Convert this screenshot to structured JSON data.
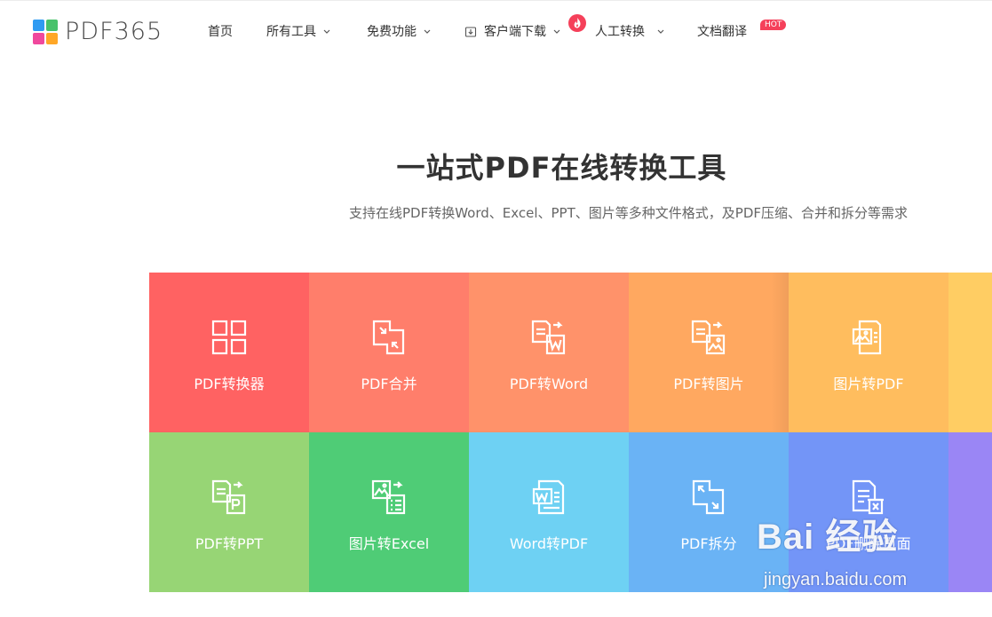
{
  "brand": {
    "name": "PDF365",
    "logo_colors": [
      "#2f9bf2",
      "#48c26b",
      "#f0489d",
      "#ffa726"
    ]
  },
  "nav": {
    "items": [
      {
        "label": "首页"
      },
      {
        "label": "所有工具"
      },
      {
        "label": "免费功能"
      },
      {
        "label": "客户端下载"
      },
      {
        "label": "人工转换"
      },
      {
        "label": "文档翻译"
      }
    ],
    "hot_badge": "HOT",
    "icons": {
      "download": "download-icon",
      "fire": "fire-icon",
      "chevron": "chevron-down-icon"
    }
  },
  "hero": {
    "title": "一站式PDF在线转换工具",
    "subtitle": "支持在线PDF转换Word、Excel、PPT、图片等多种文件格式，及PDF压缩、合并和拆分等需求"
  },
  "tools": [
    {
      "label": "PDF转换器",
      "color": "#ff6262",
      "icon": "grid-icon"
    },
    {
      "label": "PDF合并",
      "color": "#ff7e6b",
      "icon": "merge-icon"
    },
    {
      "label": "PDF转Word",
      "color": "#ff926a",
      "icon": "pdf-to-word-icon"
    },
    {
      "label": "PDF转图片",
      "color": "#ffa860",
      "icon": "pdf-to-image-icon"
    },
    {
      "label": "图片转PDF",
      "color": "#ffbd5e",
      "icon": "image-to-pdf-icon"
    },
    {
      "label": "",
      "color": "#ffcd63",
      "icon": ""
    },
    {
      "label": "PDF转PPT",
      "color": "#97d575",
      "icon": "pdf-to-ppt-icon"
    },
    {
      "label": "图片转Excel",
      "color": "#4fcc76",
      "icon": "image-to-excel-icon"
    },
    {
      "label": "Word转PDF",
      "color": "#6ed1f3",
      "icon": "word-to-pdf-icon"
    },
    {
      "label": "PDF拆分",
      "color": "#6ab3f5",
      "icon": "split-icon"
    },
    {
      "label": "PDF删除页面",
      "color": "#7395f7",
      "icon": "delete-page-icon"
    },
    {
      "label": "",
      "color": "#9a86f5",
      "icon": ""
    }
  ],
  "watermark": {
    "main": "Bai 经验",
    "sub": "jingyan.baidu.com"
  }
}
